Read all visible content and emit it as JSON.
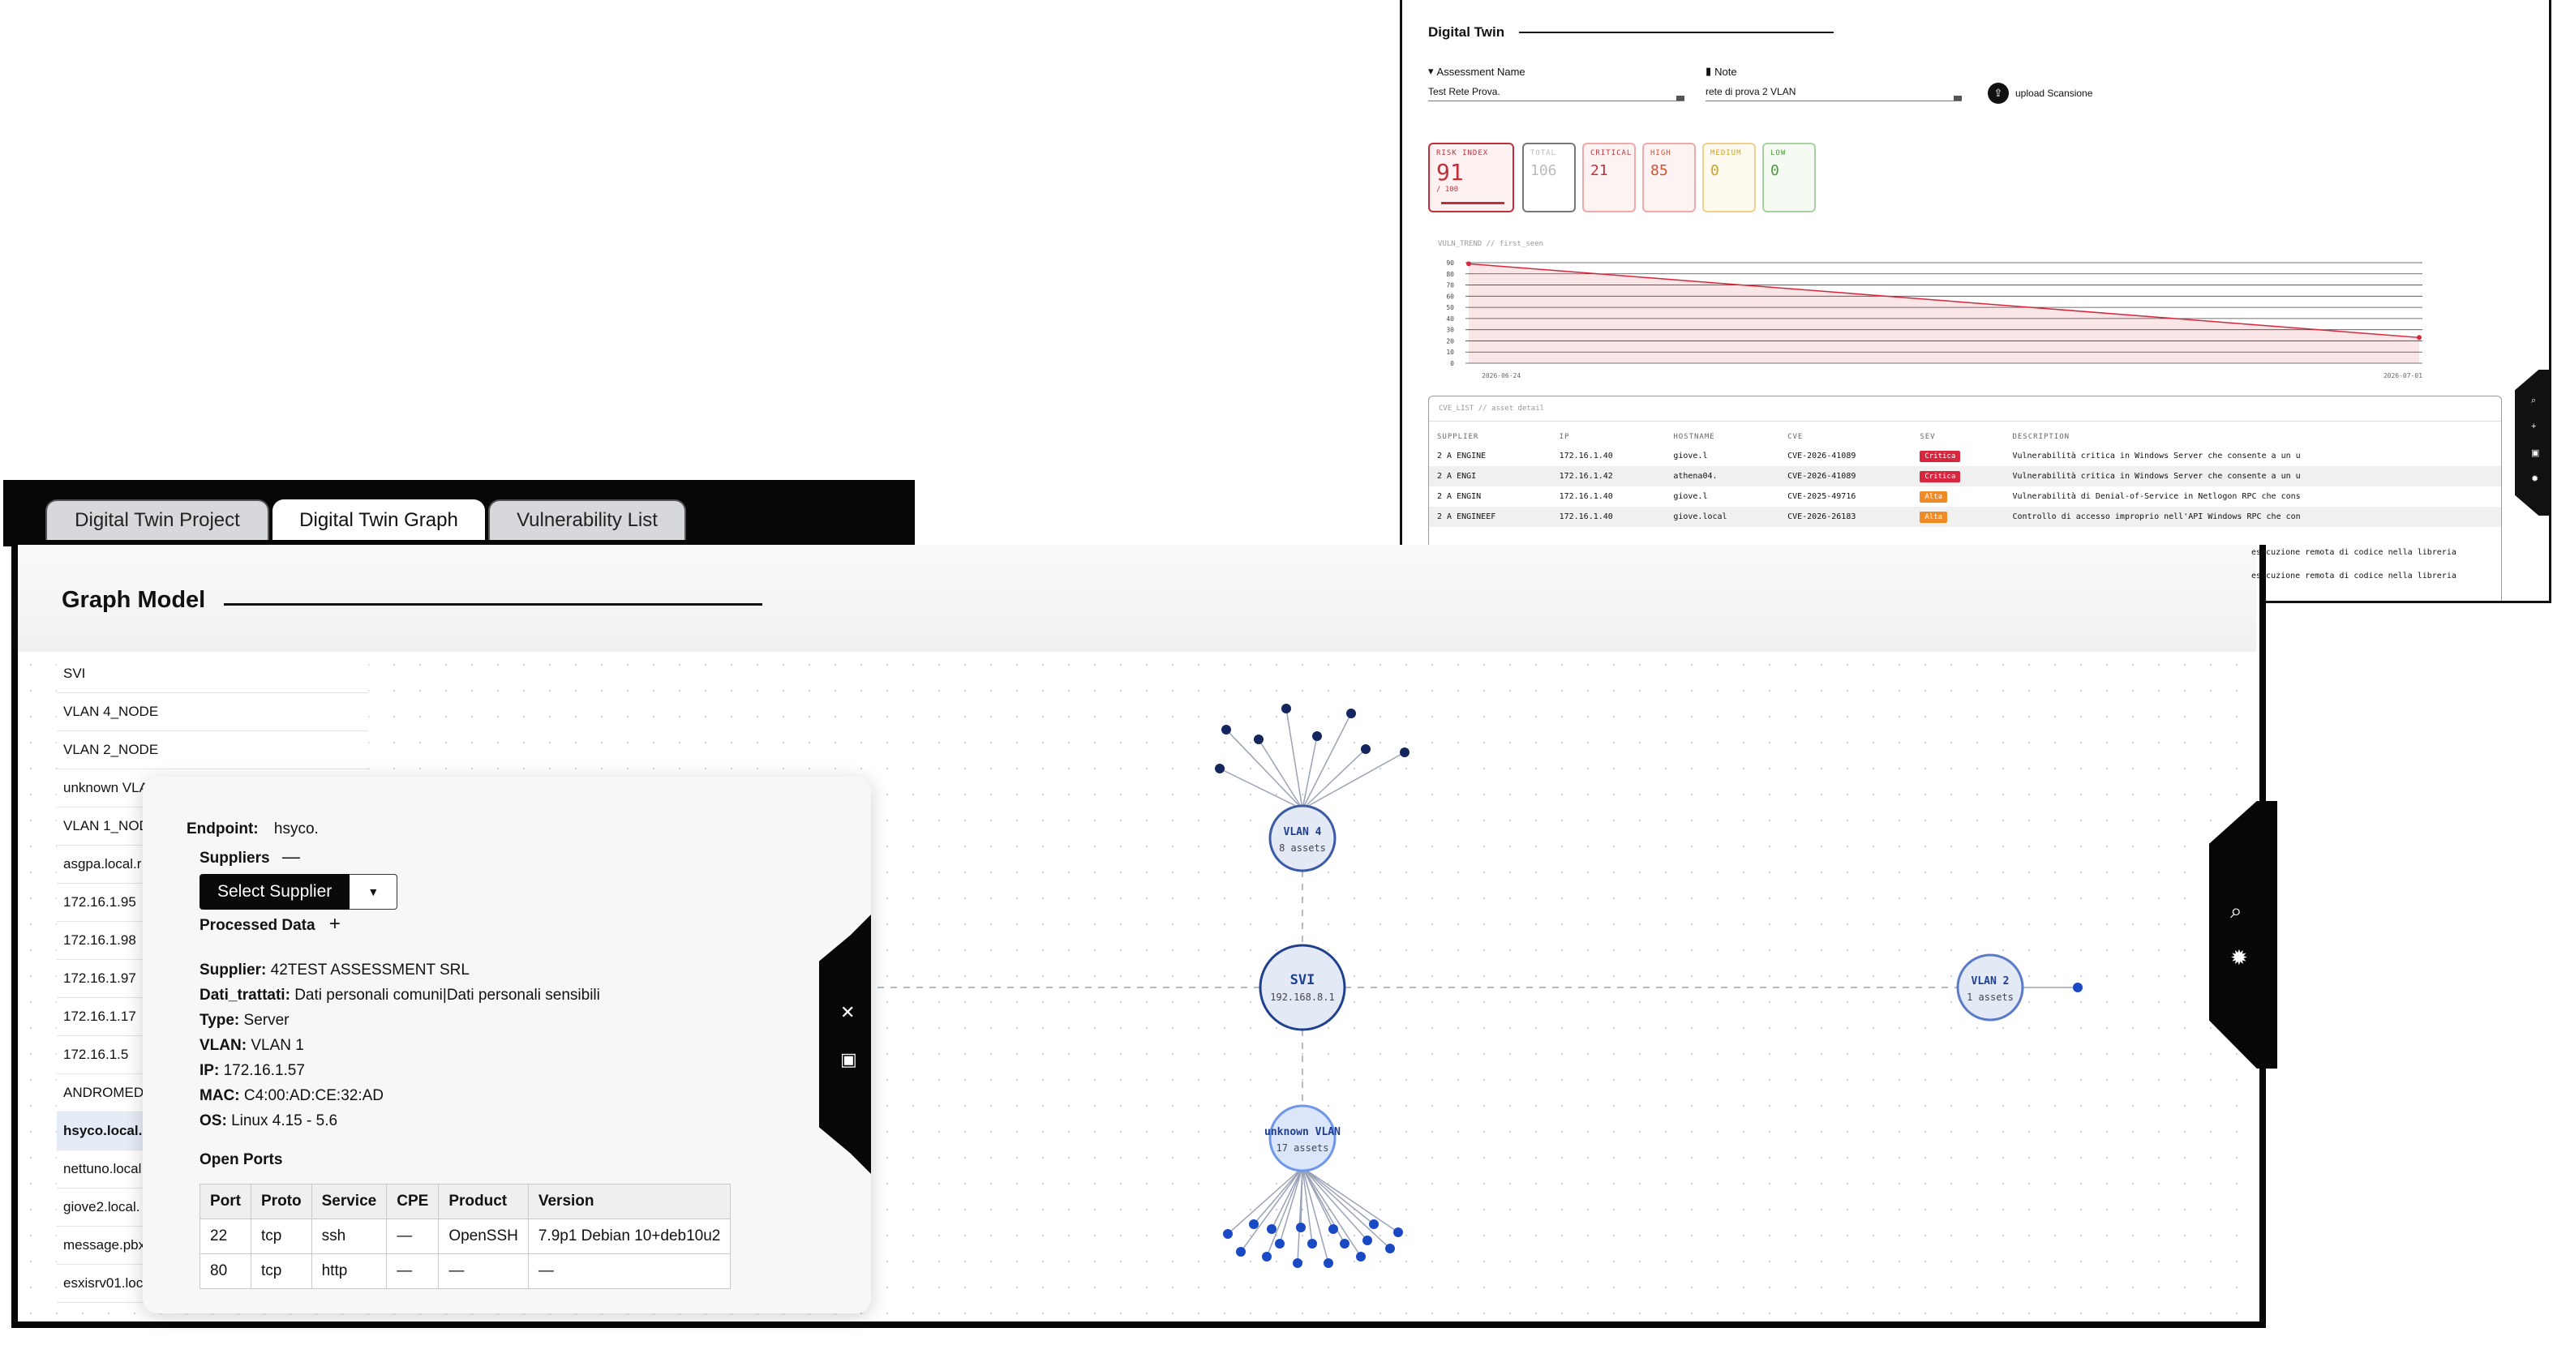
{
  "back": {
    "title": "Digital Twin",
    "assessment_label": "Assessment Name",
    "assessment_value": "Test Rete Prova.",
    "note_label": "Note",
    "note_value": "rete di prova 2 VLAN",
    "upload_label": "upload Scansione",
    "stats": {
      "risk_label": "RISK INDEX",
      "risk_value": "91",
      "risk_sub": "/ 100",
      "total_label": "TOTAL",
      "total_value": "106",
      "critical_label": "CRITICAL",
      "critical_value": "21",
      "high_label": "HIGH",
      "high_value": "85",
      "medium_label": "MEDIUM",
      "medium_value": "0",
      "low_label": "LOW",
      "low_value": "0"
    },
    "trend_label": "VULN_TREND // first_seen",
    "trend_chart": {
      "y_ticks": [
        "90",
        "80",
        "70",
        "60",
        "50",
        "40",
        "30",
        "20",
        "10",
        "0"
      ],
      "x_start": "2026-06-24",
      "x_end": "2026-07-01",
      "values": [
        89,
        23
      ]
    },
    "cve_caption": "CVE_LIST // asset detail",
    "cve_headers": [
      "SUPPLIER",
      "IP",
      "HOSTNAME",
      "CVE",
      "SEV",
      "DESCRIPTION"
    ],
    "cve_rows": [
      {
        "supplier": "2 A ENGINE",
        "ip": "172.16.1.40",
        "host": "giove.l",
        "cve": "CVE-2026-41089",
        "sev": "Critica",
        "desc": "Vulnerabilità critica in Windows Server che consente a un u"
      },
      {
        "supplier": "2 A ENGI",
        "ip": "172.16.1.42",
        "host": "athena04.",
        "cve": "CVE-2026-41089",
        "sev": "Critica",
        "desc": "Vulnerabilità critica in Windows Server che consente a un u"
      },
      {
        "supplier": "2 A ENGIN",
        "ip": "172.16.1.40",
        "host": "giove.l",
        "cve": "CVE-2025-49716",
        "sev": "Alta",
        "desc": "Vulnerabilità di Denial-of-Service in Netlogon RPC che cons"
      },
      {
        "supplier": "2 A ENGINEEF",
        "ip": "172.16.1.40",
        "host": "giove.local",
        "cve": "CVE-2026-26183",
        "sev": "Alta",
        "desc": "Controllo di accesso improprio nell'API Windows RPC che con"
      }
    ],
    "cve_overflow": [
      "esecuzione remota di codice nella libreria",
      "esecuzione remota di codice nella libreria"
    ]
  },
  "tabs": [
    "Digital Twin Project",
    "Digital Twin Graph",
    "Vulnerability List"
  ],
  "graph": {
    "title": "Graph Model",
    "nodes_list": [
      "SVI",
      "VLAN 4_NODE",
      "VLAN 2_NODE",
      "unknown VLA",
      "VLAN 1_NOD",
      "asgpa.local.r",
      "172.16.1.95",
      "172.16.1.98",
      "172.16.1.97",
      "172.16.1.17",
      "172.16.1.5",
      "ANDROMEDA",
      "hsyco.local.",
      "nettuno.local",
      "giove2.local.",
      "message.pbx",
      "esxisrv01.loc"
    ],
    "selected_index": 12,
    "svi_label": "SVI",
    "svi_ip": "192.168.8.1",
    "vlan4_label": "VLAN 4",
    "vlan4_assets": "8 assets",
    "vlan2_label": "VLAN 2",
    "vlan2_assets": "1 assets",
    "unknown_label": "unknown VLAN",
    "unknown_assets": "17 assets"
  },
  "endpoint": {
    "label": "Endpoint:",
    "value": "hsyco.",
    "suppliers_label": "Suppliers",
    "select_supplier": "Select Supplier",
    "processed_label": "Processed Data",
    "supplier_k": "Supplier:",
    "supplier_v": "42TEST ASSESSMENT SRL",
    "dati_k": "Dati_trattati:",
    "dati_v": "Dati personali comuni|Dati personali sensibili",
    "type_k": "Type:",
    "type_v": "Server",
    "vlan_k": "VLAN:",
    "vlan_v": "VLAN 1",
    "ip_k": "IP:",
    "ip_v": "172.16.1.57",
    "mac_k": "MAC:",
    "mac_v": "C4:00:AD:CE:32:AD",
    "os_k": "OS:",
    "os_v": "Linux 4.15 - 5.6",
    "open_ports_label": "Open Ports",
    "port_headers": [
      "Port",
      "Proto",
      "Service",
      "CPE",
      "Product",
      "Version"
    ],
    "ports": [
      [
        "22",
        "tcp",
        "ssh",
        "—",
        "OpenSSH",
        "7.9p1 Debian 10+deb10u2"
      ],
      [
        "80",
        "tcp",
        "http",
        "—",
        "—",
        "—"
      ]
    ]
  },
  "colors": {
    "accent_blue": "#1f3f8f",
    "critical": "#d7263d",
    "high": "#f08a24"
  }
}
